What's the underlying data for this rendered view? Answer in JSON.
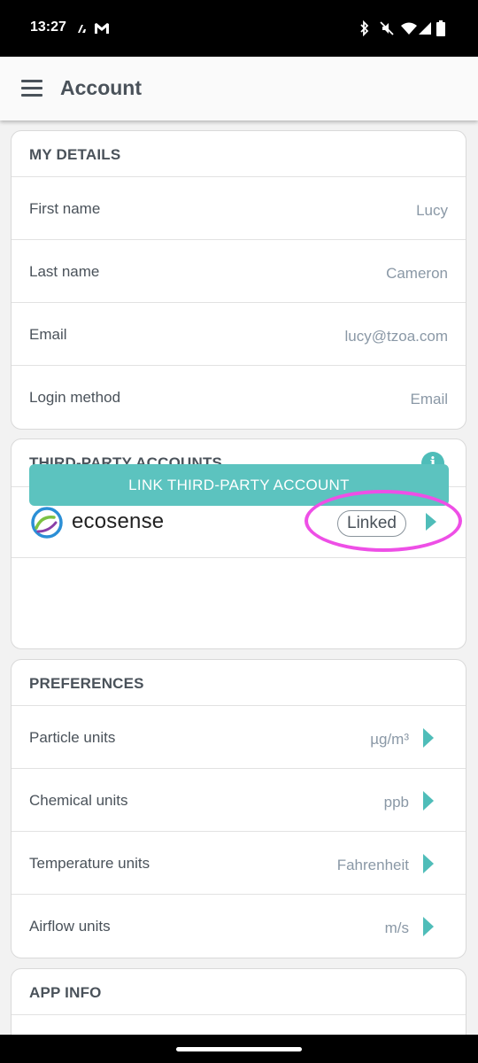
{
  "status_bar": {
    "time": "13:27"
  },
  "app_bar": {
    "title": "Account"
  },
  "my_details": {
    "title": "MY DETAILS",
    "rows": [
      {
        "label": "First name",
        "value": "Lucy"
      },
      {
        "label": "Last name",
        "value": "Cameron"
      },
      {
        "label": "Email",
        "value": "lucy@tzoa.com"
      },
      {
        "label": "Login method",
        "value": "Email"
      }
    ]
  },
  "third_party": {
    "title": "THIRD-PARTY ACCOUNTS",
    "info_symbol": "i",
    "account_name": "ecosense",
    "status": "Linked",
    "link_button": "LINK THIRD-PARTY ACCOUNT"
  },
  "preferences": {
    "title": "PREFERENCES",
    "rows": [
      {
        "label": "Particle units",
        "value": "µg/m³"
      },
      {
        "label": "Chemical units",
        "value": "ppb"
      },
      {
        "label": "Temperature units",
        "value": "Fahrenheit"
      },
      {
        "label": "Airflow units",
        "value": "m/s"
      }
    ]
  },
  "app_info": {
    "title": "APP INFO"
  },
  "colors": {
    "accent": "#4fbdb9",
    "highlight": "#ee4fe6",
    "text": "#4a525a",
    "value_text": "#8a98a6"
  }
}
